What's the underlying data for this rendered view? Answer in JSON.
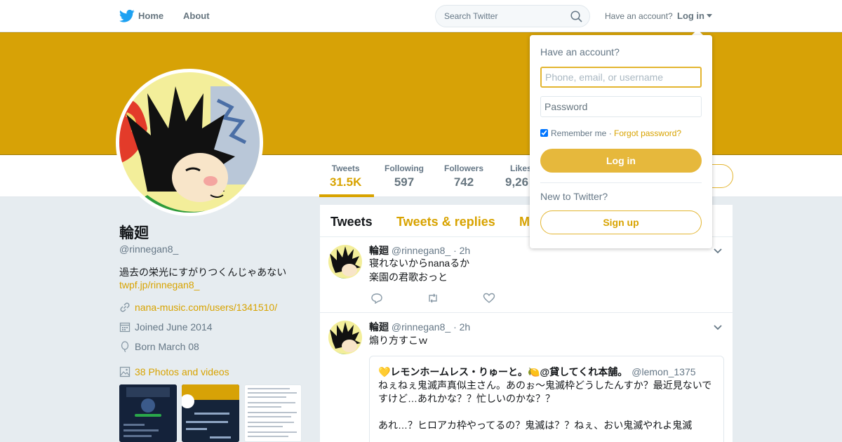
{
  "colors": {
    "accent": "#d8a300",
    "banner": "#d7a206",
    "button": "#e6b83c"
  },
  "nav": {
    "home_label": "Home",
    "about_label": "About",
    "search_placeholder": "Search Twitter",
    "have_account": "Have an account?",
    "login_label": "Log in"
  },
  "profile": {
    "name": "輪廻",
    "handle": "@rinnegan8_",
    "bio": "過去の栄光にすがりつくんじゃあない",
    "bio_link": "twpf.jp/rinnegan8_",
    "website": "nana-music.com/users/1341510/",
    "joined": "Joined June 2014",
    "born": "Born March 08",
    "photos_label": "38 Photos and videos"
  },
  "stats": [
    {
      "label": "Tweets",
      "value": "31.5K"
    },
    {
      "label": "Following",
      "value": "597"
    },
    {
      "label": "Followers",
      "value": "742"
    },
    {
      "label": "Likes",
      "value": "9,26"
    }
  ],
  "timeline": {
    "tabs": [
      "Tweets",
      "Tweets & replies",
      "M"
    ],
    "tweets": [
      {
        "name": "輪廻",
        "handle": "@rinnegan8_",
        "time": "· 2h",
        "lines": [
          "寝れないからnanaるか",
          "楽園の君歌おっと"
        ]
      },
      {
        "name": "輪廻",
        "handle": "@rinnegan8_",
        "time": "· 2h",
        "lines": [
          "煽り方すこｗ"
        ],
        "quote": {
          "name": "💛レモンホームレス・りゅーと。🍋@貸してくれ本舗。",
          "handle": "@lemon_1375",
          "text": "ねぇねぇ鬼滅声真似主さん。あのぉ〜鬼滅枠どうしたんすか？最近見ないですけど…あれかな？？忙しいのかな？？\n\nあれ…？ヒロアカ枠やってるの？鬼滅は？？ねぇ、おい鬼滅やれよ鬼滅"
        }
      }
    ]
  },
  "login_dropdown": {
    "title": "Have an account?",
    "username_placeholder": "Phone, email, or username",
    "password_placeholder": "Password",
    "remember_label": "Remember me",
    "separator": "·",
    "forgot_label": "Forgot password?",
    "login_button": "Log in",
    "new_label": "New to Twitter?",
    "signup_button": "Sign up"
  }
}
